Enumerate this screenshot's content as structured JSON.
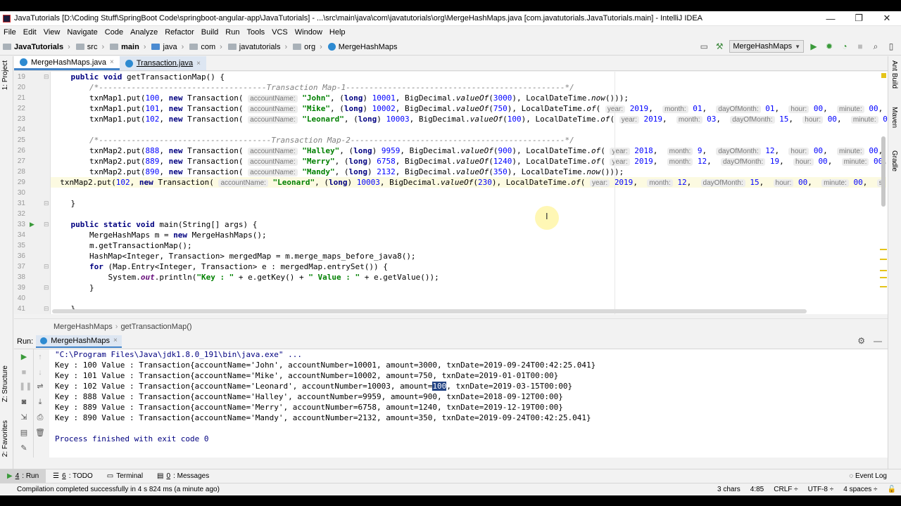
{
  "window": {
    "title": "JavaTutorials [D:\\Coding Stuff\\SpringBoot Code\\springboot-angular-app\\JavaTutorials] - ...\\src\\main\\java\\com\\javatutorials\\org\\MergeHashMaps.java [com.javatutorials.JavaTutorials.main] - IntelliJ IDEA",
    "minimize": "—",
    "maximize": "❐",
    "close": "✕"
  },
  "menu": [
    "File",
    "Edit",
    "View",
    "Navigate",
    "Code",
    "Analyze",
    "Refactor",
    "Build",
    "Run",
    "Tools",
    "VCS",
    "Window",
    "Help"
  ],
  "nav": {
    "crumbs": [
      "JavaTutorials",
      "src",
      "main",
      "java",
      "com",
      "javatutorials",
      "org",
      "MergeHashMaps"
    ],
    "run_config": "MergeHashMaps"
  },
  "left_tools": [
    "1: Project",
    "Z: Structure",
    "2: Favorites"
  ],
  "right_tools": [
    "Ant Build",
    "Maven",
    "Gradle"
  ],
  "tabs": [
    {
      "label": "MergeHashMaps.java",
      "close": "×"
    },
    {
      "label": "Transaction.java",
      "close": "×"
    }
  ],
  "editor": {
    "line_numbers": [
      "19",
      "20",
      "21",
      "22",
      "23",
      "24",
      "25",
      "26",
      "27",
      "28",
      "29",
      "30",
      "31",
      "32",
      "33",
      "34",
      "35",
      "36",
      "37",
      "38",
      "39",
      "40",
      "41"
    ]
  },
  "code_breadcrumb": [
    "MergeHashMaps",
    "getTransactionMap()"
  ],
  "run_panel": {
    "label": "Run:",
    "tab": "MergeHashMaps",
    "tab_close": "×",
    "output": [
      "\"C:\\Program Files\\Java\\jdk1.8.0_191\\bin\\java.exe\" ...",
      "Key : 100 Value : Transaction{accountName='John', accountNumber=10001, amount=3000, txnDate=2019-09-24T00:42:25.041}",
      "Key : 101 Value : Transaction{accountName='Mike', accountNumber=10002, amount=750, txnDate=2019-01-01T00:00}",
      "Key : 102 Value : Transaction{accountName='Leonard', accountNumber=10003, amount=",
      "Key : 888 Value : Transaction{accountName='Halley', accountNumber=9959, amount=900, txnDate=2018-09-12T00:00}",
      "Key : 889 Value : Transaction{accountName='Merry', accountNumber=6758, amount=1240, txnDate=2019-12-19T00:00}",
      "Key : 890 Value : Transaction{accountName='Mandy', accountNumber=2132, amount=350, txnDate=2019-09-24T00:42:25.041}",
      "",
      "Process finished with exit code 0"
    ],
    "selected_text": "100",
    "after_selected": ", txnDate=2019-03-15T00:00}"
  },
  "bottom_tools": [
    {
      "num": "4",
      "label": ": Run"
    },
    {
      "num": "6",
      "label": ": TODO"
    },
    {
      "num": "",
      "label": "Terminal"
    },
    {
      "num": "0",
      "label": ": Messages"
    }
  ],
  "event_log": "Event Log",
  "status": {
    "message": "Compilation completed successfully in 4 s 824 ms (a minute ago)",
    "chars": "3 chars",
    "position": "4:85",
    "line_sep": "CRLF ÷",
    "encoding": "UTF-8 ÷",
    "indent": "4 spaces ÷"
  },
  "colors": {
    "accent": "#4083c9",
    "keyword": "#000080",
    "string": "#008000",
    "selection": "#214283"
  }
}
